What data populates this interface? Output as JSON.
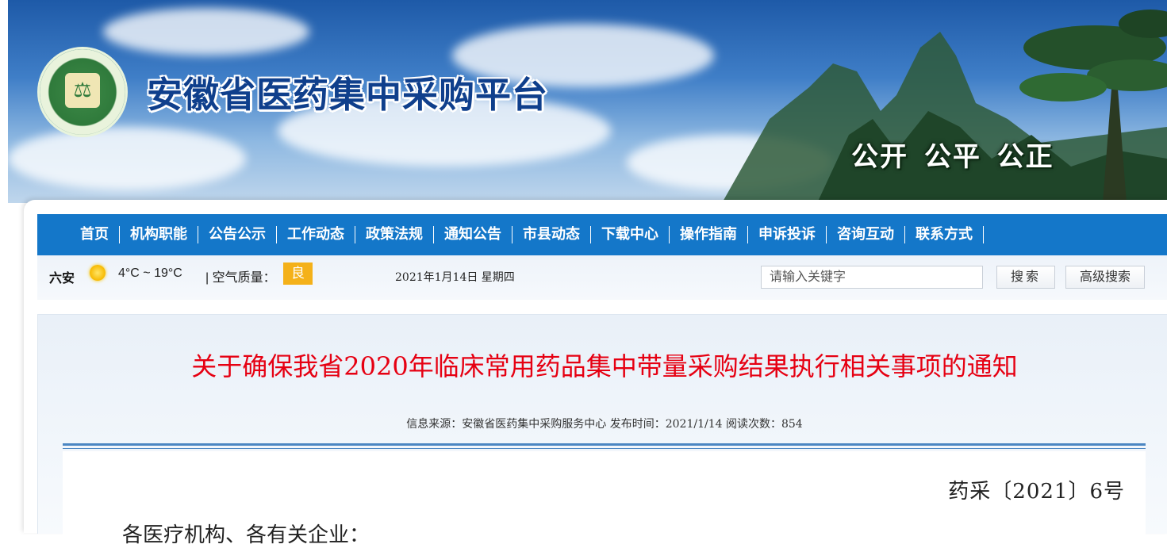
{
  "header": {
    "site_title": "安徽省医药集中采购平台",
    "slogan": "公开  公平  公正",
    "logo_emblem": "⚖"
  },
  "nav": {
    "items": [
      "首页",
      "机构职能",
      "公告公示",
      "工作动态",
      "政策法规",
      "通知公告",
      "市县动态",
      "下载中心",
      "操作指南",
      "申诉投诉",
      "咨询互动",
      "联系方式"
    ]
  },
  "infobar": {
    "city": "六安",
    "weather_icon": "sun-icon",
    "temperature": "4°C ~ 19°C",
    "aqi_label": "| 空气质量：",
    "aqi_value": "良",
    "date": "2021年1月14日  星期四",
    "search_placeholder": "请输入关键字",
    "search_button": "搜索",
    "advanced_search_button": "高级搜索"
  },
  "article": {
    "title": "关于确保我省2020年临床常用药品集中带量采购结果执行相关事项的通知",
    "meta": "信息来源：安徽省医药集中采购服务中心  发布时间：2021/1/14  阅读次数：854",
    "doc_number": "药采〔2021〕6号",
    "salutation": "各医疗机构、各有关企业："
  },
  "colors": {
    "nav_bg": "#1477c9",
    "title_red": "#e60012",
    "aqi_badge": "#f4b11a",
    "rule_blue": "#4b86c2"
  }
}
